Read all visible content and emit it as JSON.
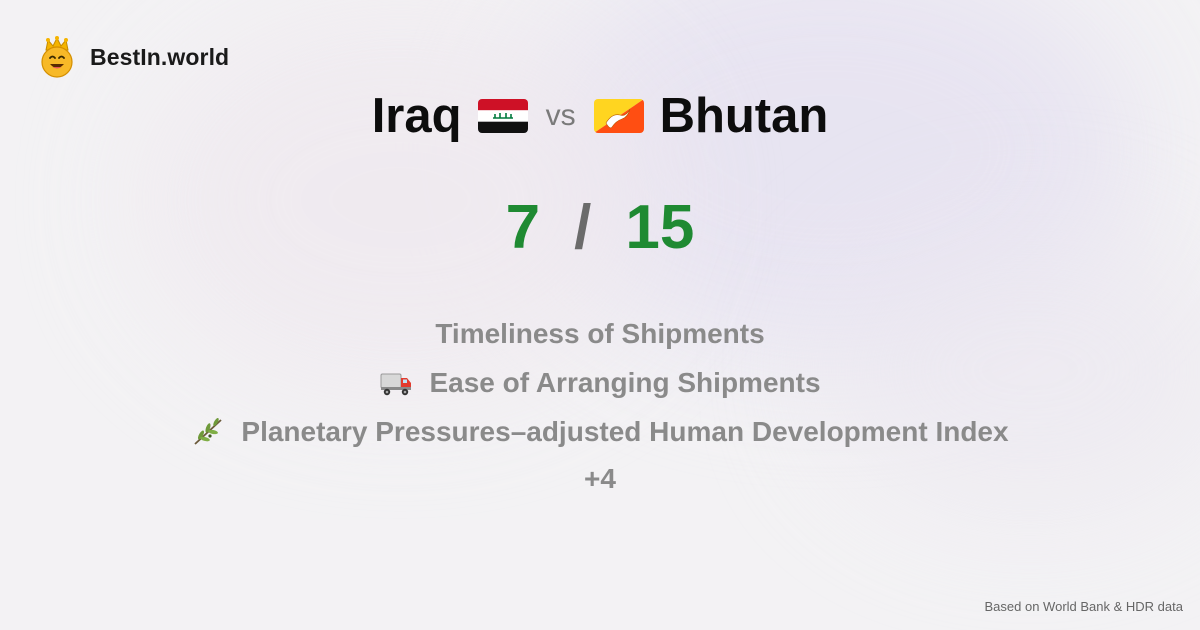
{
  "brand": {
    "name": "BestIn.world",
    "icon": "crown-smiley-icon"
  },
  "matchup": {
    "left_country": "Iraq",
    "left_flag": "iraq-flag-icon",
    "vs_label": "vs",
    "right_country": "Bhutan",
    "right_flag": "bhutan-flag-icon"
  },
  "score": {
    "left": "7",
    "separator": "/",
    "right": "15"
  },
  "metrics": [
    {
      "label": "Timeliness of Shipments",
      "icon": ""
    },
    {
      "label": "Ease of Arranging Shipments",
      "icon": "truck-icon"
    },
    {
      "label": "Planetary Pressures–adjusted Human Development Index",
      "icon": "olive-branch-icon"
    }
  ],
  "more_label": "+4",
  "footer": {
    "source": "Based on World Bank & HDR data"
  },
  "colors": {
    "score": "#1f8a32",
    "muted": "#8a8a8a",
    "title": "#0d0d0d"
  }
}
